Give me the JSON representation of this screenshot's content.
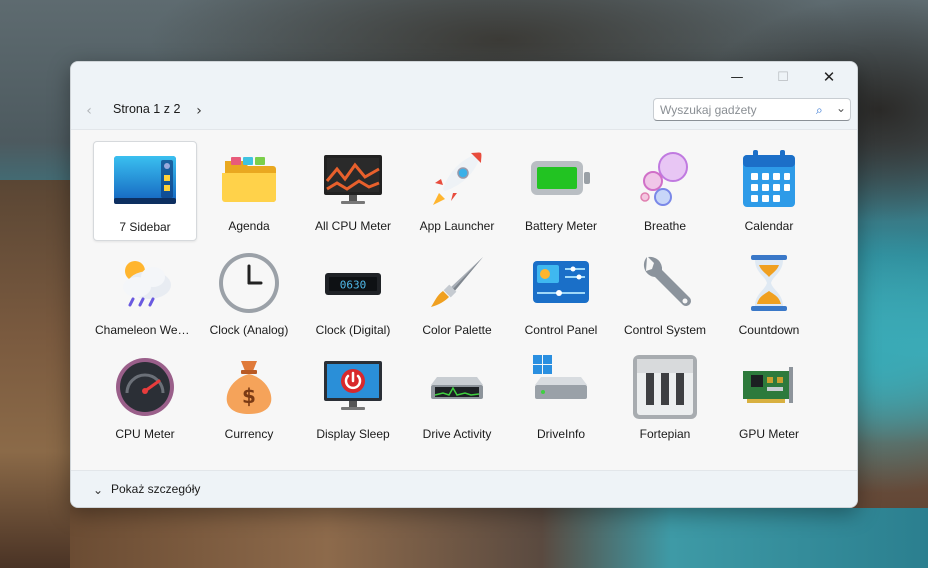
{
  "window": {
    "controls": {
      "minimize": "—",
      "maximize": "☐",
      "close": "✕"
    }
  },
  "navbar": {
    "prev_icon": "‹",
    "next_icon": "›",
    "page_label": "Strona 1 z 2",
    "search": {
      "value": "",
      "placeholder": "Wyszukaj gadżety",
      "icon": "⌕",
      "chevron": "⌄"
    }
  },
  "gadgets": [
    {
      "label": "7 Sidebar",
      "icon": "sidebar-icon",
      "selected": true
    },
    {
      "label": "Agenda",
      "icon": "folder-icon"
    },
    {
      "label": "All CPU Meter",
      "icon": "cpu-graph-monitor-icon"
    },
    {
      "label": "App Launcher",
      "icon": "rocket-icon"
    },
    {
      "label": "Battery Meter",
      "icon": "battery-icon"
    },
    {
      "label": "Breathe",
      "icon": "bubbles-icon"
    },
    {
      "label": "Calendar",
      "icon": "calendar-icon"
    },
    {
      "label": "Chameleon Weather",
      "icon": "weather-cloud-icon"
    },
    {
      "label": "Clock (Analog)",
      "icon": "analog-clock-icon"
    },
    {
      "label": "Clock (Digital)",
      "icon": "digital-clock-icon"
    },
    {
      "label": "Color Palette",
      "icon": "paintbrush-icon"
    },
    {
      "label": "Control Panel",
      "icon": "control-panel-icon"
    },
    {
      "label": "Control System",
      "icon": "wrench-icon"
    },
    {
      "label": "Countdown",
      "icon": "hourglass-icon"
    },
    {
      "label": "CPU Meter",
      "icon": "gauge-icon"
    },
    {
      "label": "Currency",
      "icon": "money-bag-icon"
    },
    {
      "label": "Display Sleep",
      "icon": "power-monitor-icon"
    },
    {
      "label": "Drive Activity",
      "icon": "drive-activity-icon"
    },
    {
      "label": "DriveInfo",
      "icon": "windows-drive-icon"
    },
    {
      "label": "Fortepian",
      "icon": "piano-icon"
    },
    {
      "label": "GPU Meter",
      "icon": "circuit-board-icon"
    }
  ],
  "clock_digital_text": "0630",
  "currency_symbol": "$",
  "footer": {
    "chevron": "⌄",
    "details_label": "Pokaż szczegóły"
  },
  "colors": {
    "accent": "#2a6fd1",
    "battery": "#22c322"
  }
}
